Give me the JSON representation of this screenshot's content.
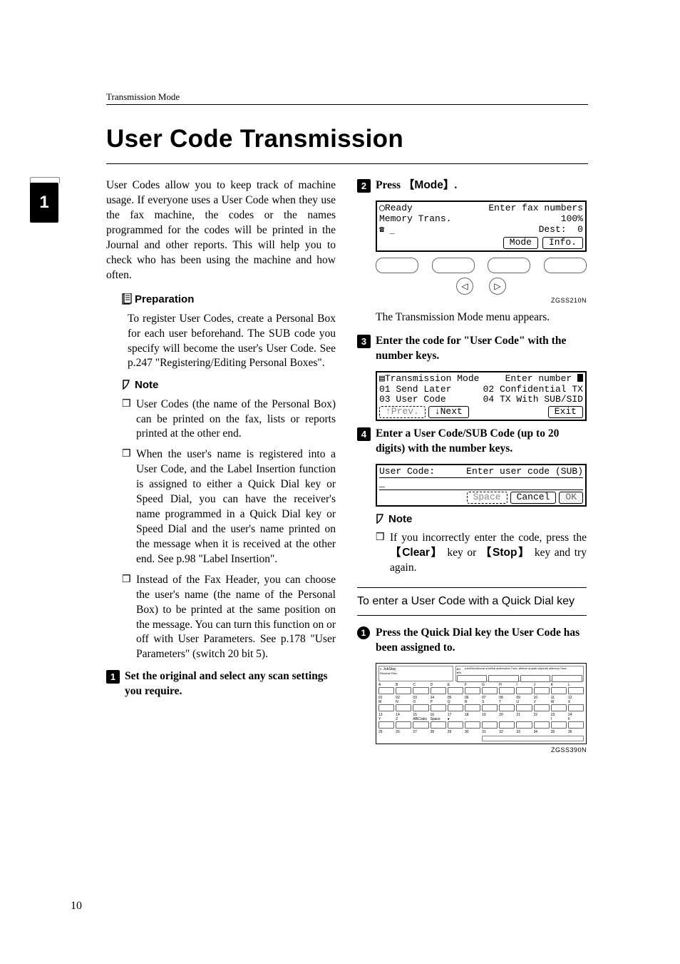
{
  "running_head": "Transmission Mode",
  "title": "User Code Transmission",
  "side_tab": "1",
  "page_number": "10",
  "intro": "User Codes allow you to keep track of machine usage. If everyone uses a User Code when they use the fax machine, the codes or the names programmed for the codes will be printed in the Journal and other reports. This will help you to check who has been using the machine and how often.",
  "prep_label": "Preparation",
  "prep_body": "To register User Codes, create a Personal Box for each user beforehand. The SUB code you specify will become the user's User Code. See p.247 \"Registering/Editing Personal Boxes\".",
  "note_label": "Note",
  "notes": [
    "User Codes (the name of the Personal Box) can be printed on the fax, lists or reports printed at the other end.",
    "When the user's name is registered into a User Code, and the Label Insertion function is assigned to either a Quick Dial key or Speed Dial, you can have the receiver's name programmed in a Quick Dial key or Speed Dial and the user's name printed on the message when it is received at the other end. See p.98 \"Label Insertion\".",
    "Instead of the Fax Header, you can choose the user's name (the name of the Personal Box) to be printed at the same position on the message. You can turn this function on or off with User Parameters. See p.178 \"User Parameters\" (switch 20 bit 5)."
  ],
  "steps": {
    "s1": "Set the original and select any scan settings you require.",
    "s2_pre": "Press ",
    "s2_key": "Mode",
    "s2_post": ".",
    "s2_result": "The Transmission Mode menu appears.",
    "s3": "Enter the code for \"User Code\" with the number keys.",
    "s4": "Enter a User Code/SUB Code (up to 20 digits) with the number keys."
  },
  "lcd1": {
    "r1l": "Ready",
    "r1r": "Enter fax numbers",
    "r2l": "Memory Trans.",
    "r2r": "100%",
    "r3l": "",
    "r3r": "Dest:  0",
    "b1": "Mode",
    "b2": "Info.",
    "fig_id": "ZGSS210N"
  },
  "lcd2": {
    "r1l": "Transmission Mode",
    "r1r": "Enter number ",
    "r2l": "01 Send Later",
    "r2r": "02 Confidential TX",
    "r3l": "03 User Code",
    "r3r": "04 TX With SUB/SID",
    "b1": "↑Prev.",
    "b2": "↓Next",
    "b3": "Exit"
  },
  "lcd3": {
    "r1l": "User Code:",
    "r1r": "Enter user code (SUB)",
    "r2": "_",
    "b1": "Space",
    "b2": "Cancel",
    "b3": "OK"
  },
  "note2_label": "Note",
  "note2_pre": "If you incorrectly enter the code, press the ",
  "note2_k1": "Clear",
  "note2_mid": " key or ",
  "note2_k2": "Stop",
  "note2_post": " key and try again.",
  "subhead": "To enter a User Code with a Quick Dial key",
  "substep1": "Press the Quick Dial key the User Code has been assigned to.",
  "kp_fig_id": "ZGSS390N",
  "kp": {
    "hdr_l1": "JobStay",
    "hdr_l2": "Reverse Disc.",
    "hdr_r": "●JobStat ●Normal ●JobStat ●Interruption Trans. ●Before ●Lighter ●Specific ●Memory Trans.",
    "row1_labels_a": [
      "A",
      "B",
      "C",
      "D",
      "E",
      "F"
    ],
    "row1_keys_a": [
      "01",
      "02",
      "03",
      "04",
      "05",
      "06"
    ],
    "row2_labels_a": [
      "M",
      "N",
      "O",
      "P",
      "Q",
      "R"
    ],
    "row2_keys_a": [
      "13",
      "14",
      "15",
      "16",
      "17",
      "18"
    ],
    "row3_labels_a": [
      "Y",
      "Z",
      "ABC/abc",
      "Space",
      "●",
      "-"
    ],
    "row3_keys_a": [
      "25",
      "26",
      "27",
      "28",
      "29",
      "30"
    ],
    "row1_labels_b": [
      "G",
      "H",
      "I",
      "J",
      "K",
      "L"
    ],
    "row1_keys_b": [
      "07",
      "08",
      "09",
      "10",
      "11",
      "12"
    ],
    "row2_labels_b": [
      "S",
      "T",
      "U",
      "V",
      "W",
      "X"
    ],
    "row2_keys_b": [
      "19",
      "20",
      "21",
      "22",
      "23",
      "24"
    ],
    "row3_labels_b": [
      "",
      "",
      "",
      "",
      "I",
      "II"
    ],
    "row3_keys_b": [
      "31",
      "32",
      "33",
      "34",
      "35",
      "36"
    ]
  }
}
